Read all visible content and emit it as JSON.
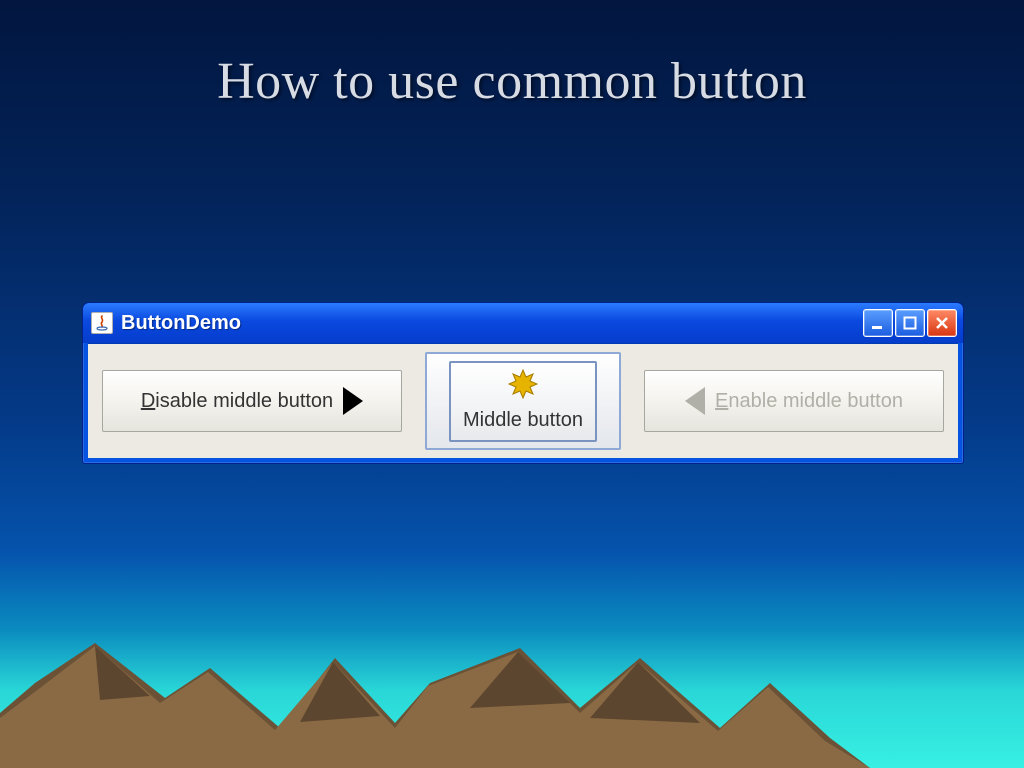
{
  "slide": {
    "title": "How to use common button"
  },
  "window": {
    "title": "ButtonDemo"
  },
  "buttons": {
    "disable_prefix": "D",
    "disable_rest": "isable middle button",
    "middle_prefix": "M",
    "middle_rest": "iddle button",
    "enable_prefix": "E",
    "enable_rest": "nable middle button"
  }
}
